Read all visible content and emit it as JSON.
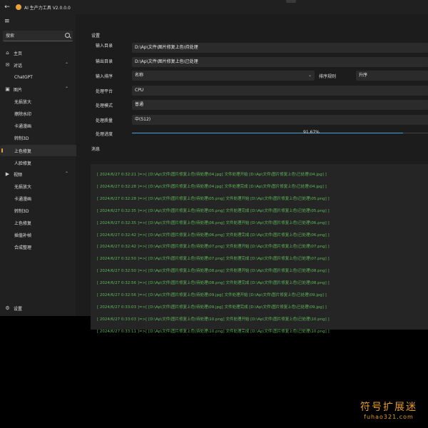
{
  "titlebar": {
    "title": "AI 生产力工具 V2.0.0.0"
  },
  "sidebar": {
    "search_placeholder": "搜索",
    "items": [
      {
        "label": "主页"
      },
      {
        "label": "对话"
      },
      {
        "label": "ChatGPT"
      },
      {
        "label": "图片"
      },
      {
        "label": "无损放大"
      },
      {
        "label": "擦除水印"
      },
      {
        "label": "卡通漫画"
      },
      {
        "label": "转制3D"
      },
      {
        "label": "上色修复"
      },
      {
        "label": "人脸修复"
      },
      {
        "label": "视频"
      },
      {
        "label": "无损放大"
      },
      {
        "label": "卡通漫画"
      },
      {
        "label": "转制3D"
      },
      {
        "label": "上色修复"
      },
      {
        "label": "插值补帧"
      },
      {
        "label": "合成整理"
      }
    ],
    "settings_label": "设置"
  },
  "settings": {
    "section_title": "设置",
    "input_dir_label": "输入目录",
    "input_dir_value": "D:\\Ap\\文件\\图片修复上色\\待处理",
    "output_dir_label": "输出目录",
    "output_dir_value": "D:\\Ap\\文件\\图片修复上色\\已处理",
    "sort_label": "输入排序",
    "sort_value": "名称",
    "sort_rule_label": "排序规则",
    "sort_rule_value": "升序",
    "platform_label": "处理平台",
    "platform_value": "CPU",
    "mode_label": "处理模式",
    "mode_value": "普通",
    "quality_label": "处理质量",
    "quality_value": "中(512)",
    "progress_label": "处理进度",
    "progress_text": "91.67%",
    "progress_fraction": 0.9167
  },
  "messages": {
    "section_title": "消息",
    "lines": [
      "[ 2024/6/27 0:32:21 ]=>[ [D:\\Ap\\文件\\图片修复上色\\待处理\\04.jpg] 文件处理开始 [D:\\Ap\\文件\\图片修复上色\\已处理\\04.jpg] ]",
      "[ 2024/6/27 0:32:28 ]=>[ [D:\\Ap\\文件\\图片修复上色\\待处理\\04.jpg] 文件处理完成 [D:\\Ap\\文件\\图片修复上色\\已处理\\04.jpg] ]",
      "[ 2024/6/27 0:32:28 ]=>[ [D:\\Ap\\文件\\图片修复上色\\待处理\\05.png] 文件处理开始 [D:\\Ap\\文件\\图片修复上色\\已处理\\05.png] ]",
      "[ 2024/6/27 0:32:35 ]=>[ [D:\\Ap\\文件\\图片修复上色\\待处理\\05.png] 文件处理完成 [D:\\Ap\\文件\\图片修复上色\\已处理\\05.png] ]",
      "[ 2024/6/27 0:32:35 ]=>[ [D:\\Ap\\文件\\图片修复上色\\待处理\\06.png] 文件处理开始 [D:\\Ap\\文件\\图片修复上色\\已处理\\06.png] ]",
      "[ 2024/6/27 0:32:42 ]=>[ [D:\\Ap\\文件\\图片修复上色\\待处理\\06.png] 文件处理完成 [D:\\Ap\\文件\\图片修复上色\\已处理\\06.png] ]",
      "[ 2024/6/27 0:32:42 ]=>[ [D:\\Ap\\文件\\图片修复上色\\待处理\\07.png] 文件处理开始 [D:\\Ap\\文件\\图片修复上色\\已处理\\07.png] ]",
      "[ 2024/6/27 0:32:50 ]=>[ [D:\\Ap\\文件\\图片修复上色\\待处理\\07.png] 文件处理完成 [D:\\Ap\\文件\\图片修复上色\\已处理\\07.png] ]",
      "[ 2024/6/27 0:32:50 ]=>[ [D:\\Ap\\文件\\图片修复上色\\待处理\\08.png] 文件处理开始 [D:\\Ap\\文件\\图片修复上色\\已处理\\08.png] ]",
      "[ 2024/6/27 0:32:56 ]=>[ [D:\\Ap\\文件\\图片修复上色\\待处理\\08.png] 文件处理完成 [D:\\Ap\\文件\\图片修复上色\\已处理\\08.png] ]",
      "[ 2024/6/27 0:32:56 ]=>[ [D:\\Ap\\文件\\图片修复上色\\待处理\\09.jpg] 文件处理开始 [D:\\Ap\\文件\\图片修复上色\\已处理\\09.jpg] ]",
      "[ 2024/6/27 0:33:03 ]=>[ [D:\\Ap\\文件\\图片修复上色\\待处理\\09.jpg] 文件处理完成 [D:\\Ap\\文件\\图片修复上色\\已处理\\09.jpg] ]",
      "[ 2024/6/27 0:33:03 ]=>[ [D:\\Ap\\文件\\图片修复上色\\待处理\\10.png] 文件处理开始 [D:\\Ap\\文件\\图片修复上色\\已处理\\10.png] ]",
      "[ 2024/6/27 0:33:11 ]=>[ [D:\\Ap\\文件\\图片修复上色\\待处理\\10.png] 文件处理完成 [D:\\Ap\\文件\\图片修复上色\\已处理\\10.png] ]"
    ]
  },
  "watermark": {
    "cn": "符号扩展迷",
    "en": "fuhao321.com"
  },
  "colors": {
    "accent": "#e9a23b",
    "log_text": "#5fb85a",
    "progress": "#4aa3df"
  }
}
